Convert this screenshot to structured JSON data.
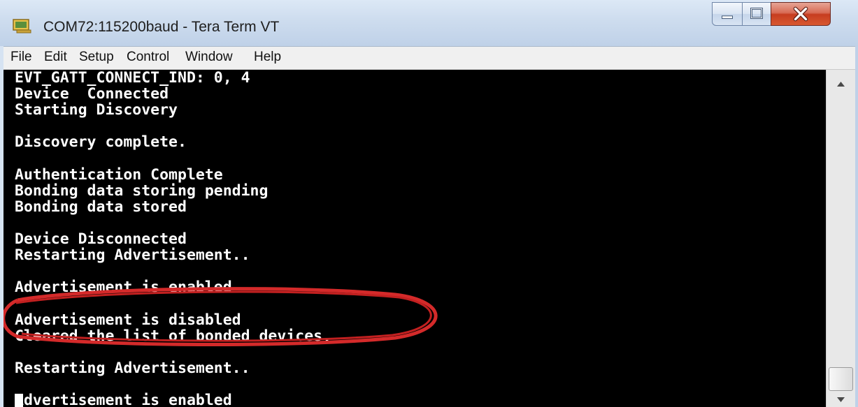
{
  "window": {
    "title": "COM72:115200baud - Tera Term VT",
    "icon": "tera-term-app-icon",
    "controls": [
      "minimize-icon",
      "maximize-icon",
      "close-icon"
    ],
    "colors": {
      "close_button": "#c63d20",
      "terminal_bg": "#000000",
      "terminal_fg": "#ffffff",
      "annotation": "#d42a2a"
    }
  },
  "menu": {
    "items": [
      "File",
      "Edit",
      "Setup",
      "Control",
      "Window",
      "Help"
    ]
  },
  "terminal": {
    "lines": [
      "EVT_GATT_CONNECT_IND: 0, 4",
      "Device  Connected",
      "Starting Discovery",
      "",
      "Discovery complete.",
      "",
      "Authentication Complete",
      "Bonding data storing pending",
      "Bonding data stored",
      "",
      "Device Disconnected",
      "Restarting Advertisement..",
      "",
      "Advertisement is enabled",
      "",
      "Advertisement is disabled",
      "Cleared the list of bonded devices.",
      "",
      "Restarting Advertisement..",
      "",
      "Advertisement is enabled"
    ],
    "highlighted_lines": [
      15,
      16
    ]
  },
  "scrollbar": {
    "icons": [
      "scroll-up-arrow-icon",
      "scroll-down-arrow-icon"
    ]
  }
}
